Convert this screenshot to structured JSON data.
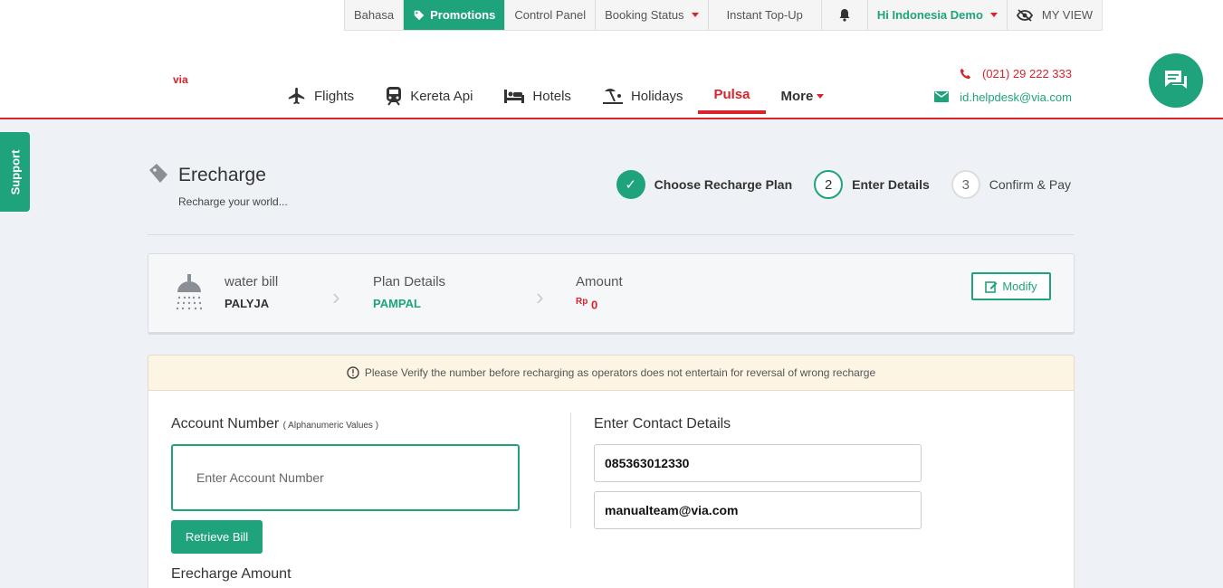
{
  "topbar": {
    "language": "Bahasa",
    "promotions": "Promotions",
    "control_panel": "Control Panel",
    "booking_status": "Booking Status",
    "instant_topup": "Instant Top-Up",
    "greeting": "Hi Indonesia Demo",
    "my_view": "MY VIEW"
  },
  "header": {
    "logo": "via",
    "nav": [
      {
        "label": "Flights",
        "icon": "plane-icon"
      },
      {
        "label": "Kereta Api",
        "icon": "train-icon"
      },
      {
        "label": "Hotels",
        "icon": "bed-icon"
      },
      {
        "label": "Holidays",
        "icon": "beach-icon"
      },
      {
        "label": "Pulsa",
        "icon": ""
      },
      {
        "label": "More",
        "icon": ""
      }
    ],
    "phone": "(021) 29 222 333",
    "email": "id.helpdesk@via.com"
  },
  "support_label": "Support",
  "page": {
    "title": "Erecharge",
    "subtitle": "Recharge your world..."
  },
  "steps": [
    {
      "number": "✓",
      "label": "Choose Recharge Plan"
    },
    {
      "number": "2",
      "label": "Enter Details"
    },
    {
      "number": "3",
      "label": "Confirm & Pay"
    }
  ],
  "summary": {
    "category_label": "water bill",
    "category_value": "PALYJA",
    "plan_label": "Plan Details",
    "plan_value": "PAMPAL",
    "amount_label": "Amount",
    "currency": "Rp",
    "amount_value": "0",
    "modify_label": "Modify"
  },
  "notice": "Please Verify the number before recharging as operators does not entertain for reversal of wrong recharge",
  "form": {
    "account_label": "Account Number",
    "account_hint": "( Alphanumeric Values )",
    "account_placeholder": "Enter Account Number",
    "retrieve_label": "Retrieve Bill",
    "amount_label": "Erecharge Amount",
    "contact_label": "Enter Contact Details",
    "phone_value": "085363012330",
    "email_value": "manualteam@via.com"
  },
  "colors": {
    "brand_green": "#1fa37c",
    "brand_red": "#d9232d"
  }
}
